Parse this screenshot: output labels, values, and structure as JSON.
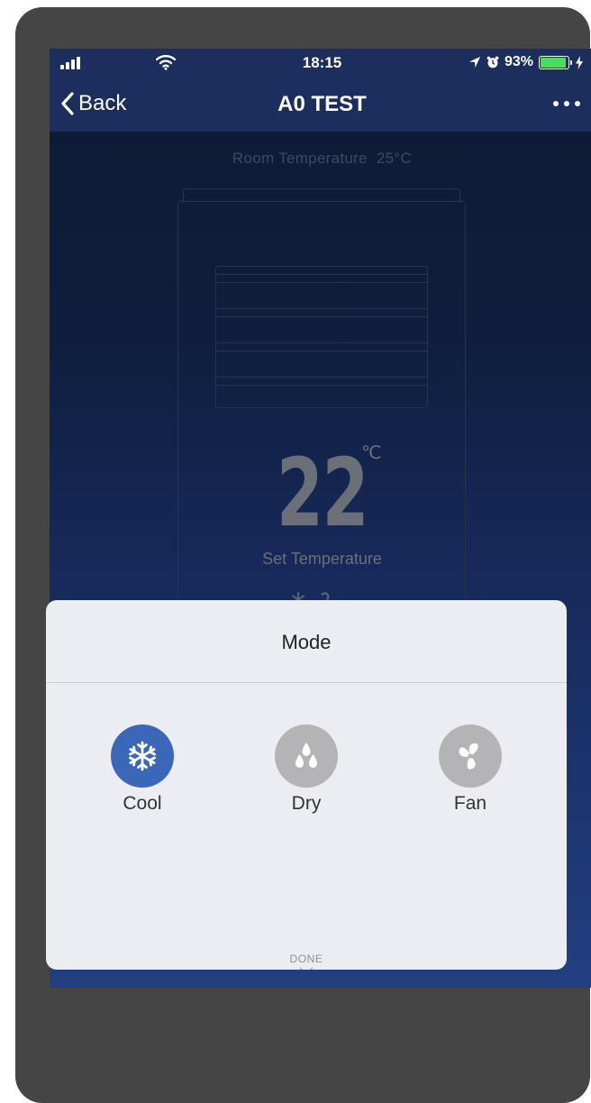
{
  "status_bar": {
    "time": "18:15",
    "battery_percent": "93%",
    "battery_level": 0.93,
    "icons": [
      "signal-icon",
      "wifi-icon",
      "location-icon",
      "alarm-icon",
      "battery-icon",
      "charging-icon"
    ]
  },
  "nav": {
    "back_label": "Back",
    "title": "A0 TEST",
    "more_icon": "more-icon"
  },
  "device": {
    "room_temperature_label": "Room Temperature",
    "room_temperature_value": "25°C",
    "set_temperature_value": "22",
    "set_temperature_unit": "℃",
    "set_temperature_label": "Set Temperature"
  },
  "mode_sheet": {
    "title": "Mode",
    "options": [
      {
        "label": "Cool",
        "icon": "snowflake-icon",
        "selected": true
      },
      {
        "label": "Dry",
        "icon": "droplets-icon",
        "selected": false
      },
      {
        "label": "Fan",
        "icon": "fan-icon",
        "selected": false
      }
    ],
    "done_label": "DONE"
  },
  "colors": {
    "nav_background": "#1b2e5e",
    "selected_mode": "#3a67b8",
    "unselected_mode": "#b4b4b7",
    "sheet_background": "#ebedf2",
    "battery_fill": "#4cd964",
    "device_frame": "#454545"
  }
}
